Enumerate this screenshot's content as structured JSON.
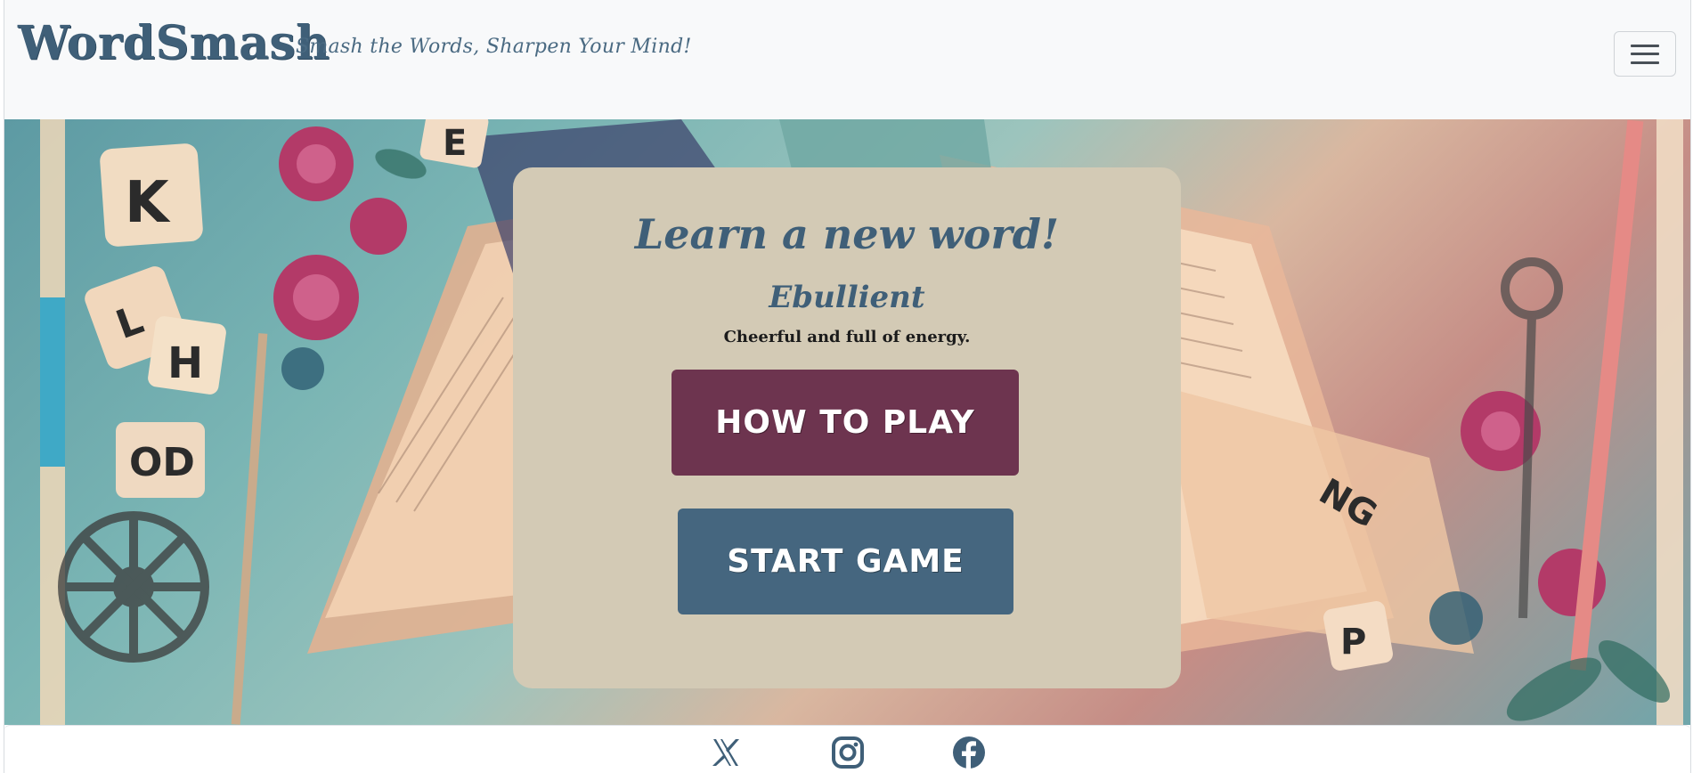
{
  "header": {
    "brand": "WordSmash",
    "tagline": "Smash the Words, Sharpen Your Mind!"
  },
  "card": {
    "title": "Learn a new word!",
    "word": "Ebullient",
    "definition": "Cheerful and full of energy.",
    "how_to_play_label": "HOW TO PLAY",
    "start_game_label": "START GAME"
  },
  "footer": {
    "social_icons": [
      "x-icon",
      "instagram-icon",
      "facebook-icon"
    ]
  },
  "colors": {
    "brand": "#3f5f78",
    "card_background": "#d3cab5",
    "how_to_play_button": "#6d344f",
    "start_game_button": "#45667f"
  }
}
